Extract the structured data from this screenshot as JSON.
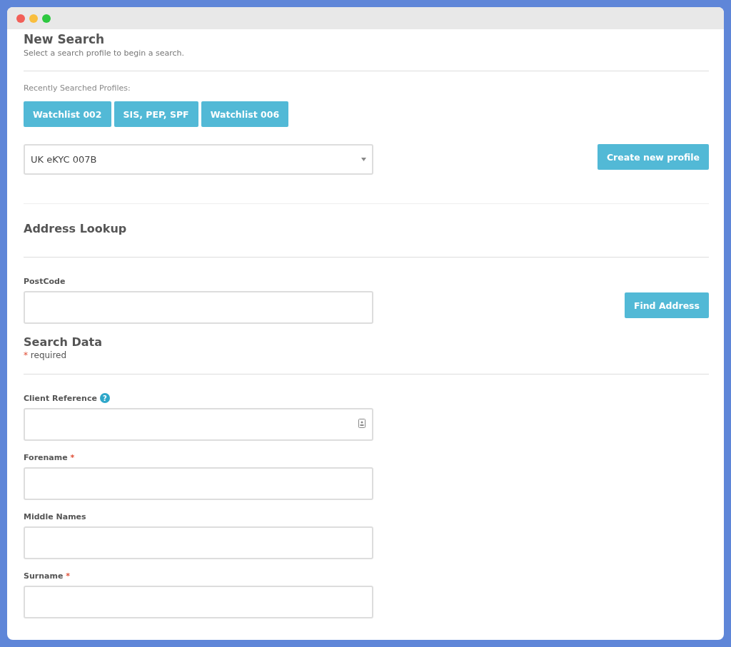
{
  "header": {
    "title": "New Search",
    "subtitle": "Select a search profile to begin a search."
  },
  "recent": {
    "label": "Recently Searched Profiles:",
    "profiles": [
      "Watchlist 002",
      "SIS, PEP, SPF",
      "Watchlist 006"
    ]
  },
  "profile_select": {
    "value": "UK eKYC 007B"
  },
  "create_button": "Create new profile",
  "address": {
    "title": "Address Lookup",
    "postcode_label": "PostCode",
    "find_button": "Find Address"
  },
  "search_data": {
    "title": "Search Data",
    "required_mark": "*",
    "required_note": "required",
    "fields": [
      {
        "label": "Client Reference",
        "required": false,
        "help": "?",
        "card_icon": true
      },
      {
        "label": "Forename",
        "required": true,
        "card_icon": false
      },
      {
        "label": "Middle Names",
        "required": false,
        "card_icon": false
      },
      {
        "label": "Surname",
        "required": true,
        "card_icon": false
      }
    ]
  }
}
